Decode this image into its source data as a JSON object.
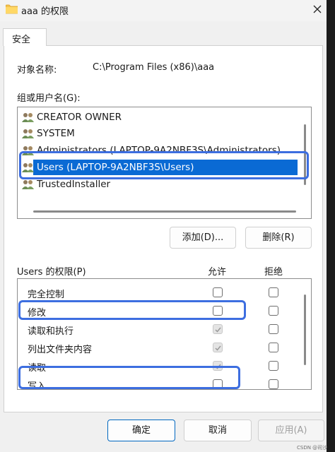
{
  "window": {
    "title": "aaa 的权限",
    "close_icon": "close-icon"
  },
  "tab": {
    "label": "安全"
  },
  "object_name": {
    "label": "对象名称:",
    "value": "C:\\Program Files (x86)\\aaa"
  },
  "groups": {
    "label": "组或用户名(G):",
    "items": [
      {
        "name": "CREATOR OWNER",
        "icon": "users-icon"
      },
      {
        "name": "SYSTEM",
        "icon": "users-icon"
      },
      {
        "name": "Administrators (LAPTOP-9A2NBF3S\\Administrators)",
        "icon": "users-icon"
      },
      {
        "name": "Users (LAPTOP-9A2NBF3S\\Users)",
        "icon": "users-icon",
        "selected": true
      },
      {
        "name": "TrustedInstaller",
        "icon": "users-icon"
      }
    ],
    "add_label": "添加(D)...",
    "remove_label": "删除(R)"
  },
  "permissions": {
    "label": "Users 的权限(P)",
    "allow_header": "允许",
    "deny_header": "拒绝",
    "rows": [
      {
        "name": "完全控制",
        "allow": false,
        "allow_disabled": false,
        "deny": false
      },
      {
        "name": "修改",
        "allow": false,
        "allow_disabled": false,
        "deny": false
      },
      {
        "name": "读取和执行",
        "allow": true,
        "allow_disabled": true,
        "deny": false
      },
      {
        "name": "列出文件夹内容",
        "allow": true,
        "allow_disabled": true,
        "deny": false
      },
      {
        "name": "读取",
        "allow": true,
        "allow_disabled": true,
        "deny": false
      },
      {
        "name": "写入",
        "allow": false,
        "allow_disabled": false,
        "deny": false
      }
    ]
  },
  "buttons": {
    "ok": "确定",
    "cancel": "取消",
    "apply": "应用(A)"
  },
  "watermark": "CSDN @司沙",
  "colors": {
    "selection": "#0a6ad4",
    "annotation": "#3d6ee0",
    "primary_border": "#0067c0"
  }
}
